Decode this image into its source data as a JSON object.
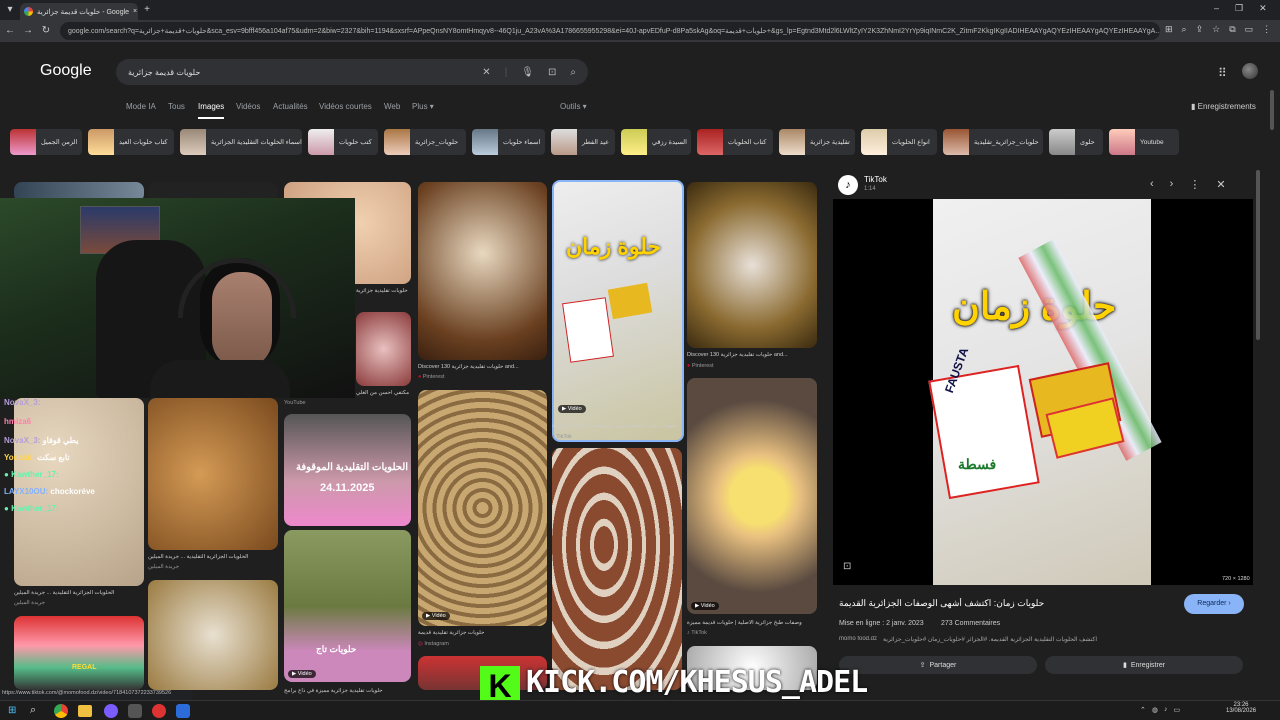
{
  "browser": {
    "tab_title": "حلويات قديمة جزائرية - Google",
    "url": "google.com/search?q=حلويات+قديمة+جزائرية&sca_esv=9bfff456a104af75&udm=2&biw=2327&bih=1194&sxsrf=APpeQnsNY8omtHmqyv8--46Q1ju_A23vA%3A1786655955298&ei=40J-apvEDfuP-d8Pa5skAg&oq=حلويات+قديمة+&gs_lp=Egtnd3Mtd2l6LWltZyIY2K3ZhNmI2YrYp9iqINmC2K_ZitmF2KkgIKgIIADIHEAAYgAQYEzIHEAAYgAQYEzIHEAAYgA..."
  },
  "google": {
    "logo": "Google",
    "query": "حلويات قديمة جزائرية",
    "save_label": "Enregistrements"
  },
  "nav": {
    "tabs": [
      "Mode IA",
      "Tous",
      "Images",
      "Vidéos",
      "Actualités",
      "Vidéos courtes",
      "Web",
      "Plus ▾"
    ],
    "tools": "Outils ▾"
  },
  "chips": [
    "الزمن الجميل",
    "كتاب حلويات العيد",
    "اسماء الحلويات التقليدية الجزائرية",
    "كتب حلويات",
    "حلويات_جزائرية",
    "اسماء حلويات",
    "عيد الفطر",
    "السيدة رزقي",
    "كتاب الحلويات",
    "تقليدية جزائرية",
    "انواع الحلويات",
    "حلويات_جزائرية_تقليدية",
    "حلوى",
    "Youtube"
  ],
  "grid": {
    "c3_top_caption": "حلويات تقليدية جزائرية",
    "c3_mid_caption": "مكتفي احسن من الغلي",
    "c4_caption": "Discover 130 حلويات تقليدية جزائرية and...",
    "c4_source": "Pinterest",
    "c5_caption": "حلويات زمان: اكتشف أشهى الوصفات الجزائرية القديمة",
    "c5_source": "TikTok",
    "c5_video": "Vidéo",
    "c6_caption": "Discover 130 حلويات تقليدية جزائرية and...",
    "c6_source": "Pinterest",
    "c3b_overlay": "الحلويات التقليدية الموقوفة",
    "c3b_date": "24.11.2025",
    "c3b_source": "YouTube",
    "c4b_caption": "حلويات جزائرية تقليدية قديمة",
    "c4b_source": "Instagram",
    "c4b_video": "Vidéo",
    "c2_caption": "الحلويات الجزائرية التقليدية ... جريدة الميلين",
    "c2_source": "جريدة الميلين",
    "c1_caption": "الحلويات الجزائرية التقليدية ... جريدة الميلين",
    "c1_source": "جريدة الميلين",
    "c6b_caption": "وصفات طبخ جزائرية الأصلية | حلويات قديمة مميزة",
    "c6b_source": "TikTok",
    "c6b_video": "Vidéo",
    "c3c_caption": "حلويات تقليدية جزائرية مميزة في ذاع برامج",
    "c3c_overlay": "حلويات تاج",
    "c3c_video": "Vidéo",
    "c1c_text": "REGAL"
  },
  "panel": {
    "source": "TikTok",
    "duration": "1:14",
    "title_ar": "حلوة زمان",
    "brand": "FAUSTA",
    "brand_ar": "فسطة",
    "dims": "720 × 1280",
    "caption": "حلويات زمان: اكتشف أشهى الوصفات الجزائرية القديمة",
    "visit": "Regarder ›",
    "date": "Mise en ligne : 2 janv. 2023",
    "comments": "273 Commentaires",
    "desc": "اكتشف الحلويات التقليدية الجزائرية القديمة. #الجزائر #حلويات_زمان #حلويات_جزائرية",
    "author": "momo food.dz",
    "share": "Partager",
    "save": "Enregistrer"
  },
  "overlay": {
    "kick": "KICK.COM/KHESUS_ADEL",
    "chat": [
      {
        "user": "NovaX_3:",
        "color": "#b39ddb",
        "msg": ""
      },
      {
        "user": "hmiza6",
        "color": "#ff80ab",
        "msg": ""
      },
      {
        "user": "NovaX_3:",
        "color": "#b39ddb",
        "msg": "يطي قوفاو"
      },
      {
        "user": "Yodakd:",
        "color": "#ffd54f",
        "msg": "تابع سكت"
      },
      {
        "user": "Kawther_17:",
        "color": "#69f0ae",
        "msg": ""
      },
      {
        "user": "LAYX10OU:",
        "color": "#82b1ff",
        "msg": "chockoréve"
      },
      {
        "user": "Kawther_17:",
        "color": "#69f0ae",
        "msg": ""
      }
    ]
  },
  "status_url": "https://www.tiktok.com/@momofood.dz/video/7184107372233739526",
  "clock": {
    "time": "23:26",
    "date": "13/08/2026"
  }
}
